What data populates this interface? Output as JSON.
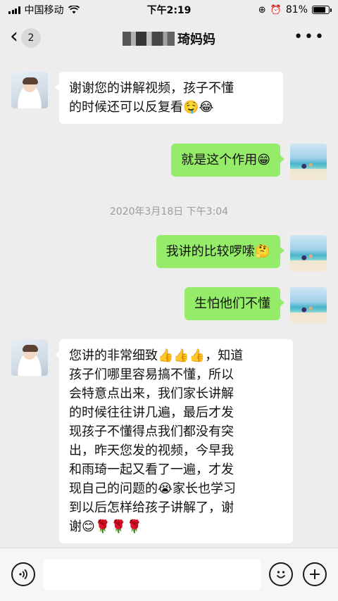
{
  "status_bar": {
    "carrier": "中国移动",
    "time": "下午2:19",
    "battery": "81%",
    "battery_level": 0.81
  },
  "nav": {
    "unread_count": "2",
    "title": "琦妈妈",
    "back_icon": "chevron-left-icon",
    "more_icon": "more-dots-icon"
  },
  "messages": [
    {
      "side": "in",
      "text": "谢谢您的讲解视频，孩子不懂\n的时候还可以反复看🤤😂"
    },
    {
      "side": "out",
      "text": "就是这个作用😁"
    },
    {
      "side": "time",
      "text": "2020年3月18日 下午3:04"
    },
    {
      "side": "out",
      "text": "我讲的比较啰嗦🤔"
    },
    {
      "side": "out",
      "text": "生怕他们不懂"
    },
    {
      "side": "in",
      "text": "您讲的非常细致👍👍👍，知道\n孩子们哪里容易搞不懂，所以\n会特意点出来，我们家长讲解\n的时候往往讲几遍，最后才发\n现孩子不懂得点我们都没有突\n出，昨天您发的视频，今早我\n和雨琦一起又看了一遍，才发\n现自己的问题的😭家长也学习\n到以后怎样给孩子讲解了，谢\n谢😊🌹🌹🌹"
    }
  ],
  "input_bar": {
    "placeholder": "",
    "voice_icon": "voice-icon",
    "emoji_icon": "emoji-icon",
    "plus_icon": "plus-icon"
  },
  "colors": {
    "background": "#ededed",
    "outgoing_bubble": "#95ec69",
    "incoming_bubble": "#ffffff"
  }
}
